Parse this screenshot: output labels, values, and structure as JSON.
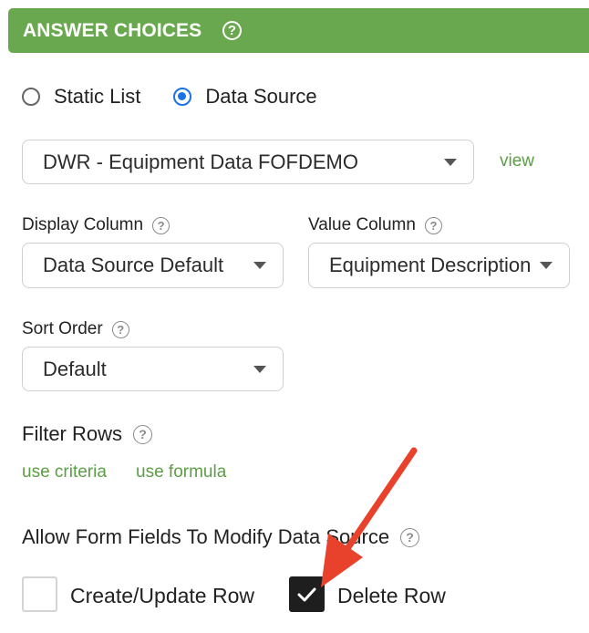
{
  "header": {
    "title": "ANSWER CHOICES",
    "help": "?"
  },
  "source_type": {
    "options": [
      {
        "label": "Static List",
        "selected": false
      },
      {
        "label": "Data Source",
        "selected": true
      }
    ]
  },
  "data_source": {
    "value": "DWR - Equipment Data FOFDEMO",
    "view_link": "view"
  },
  "display_column": {
    "label": "Display Column",
    "help": "?",
    "value": "Data Source Default"
  },
  "value_column": {
    "label": "Value Column",
    "help": "?",
    "value": "Equipment Description"
  },
  "sort_order": {
    "label": "Sort Order",
    "help": "?",
    "value": "Default"
  },
  "filter_rows": {
    "label": "Filter Rows",
    "help": "?",
    "criteria_link": "use criteria",
    "formula_link": "use formula"
  },
  "modify": {
    "label": "Allow Form Fields To Modify Data Source",
    "help": "?",
    "create_update": {
      "label": "Create/Update Row",
      "checked": false
    },
    "delete": {
      "label": "Delete Row",
      "checked": true
    }
  },
  "colors": {
    "header": "#6aa84f",
    "link": "#5c9e46",
    "radio_selected": "#1a73e8",
    "arrow": "#e8412c"
  }
}
